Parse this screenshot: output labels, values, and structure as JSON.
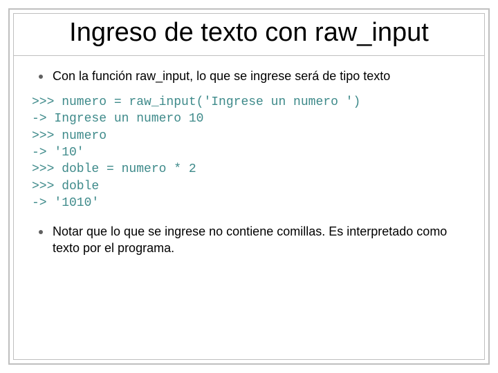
{
  "title": "Ingreso de texto con raw_input",
  "bullets": {
    "first": "Con la función raw_input, lo que se ingrese será de tipo texto",
    "second": "Notar que lo que se ingrese no contiene comillas.  Es interpretado como texto por el programa."
  },
  "code": ">>> numero = raw_input('Ingrese un numero ')\n-> Ingrese un numero 10\n>>> numero\n-> '10'\n>>> doble = numero * 2\n>>> doble\n-> '1010'"
}
